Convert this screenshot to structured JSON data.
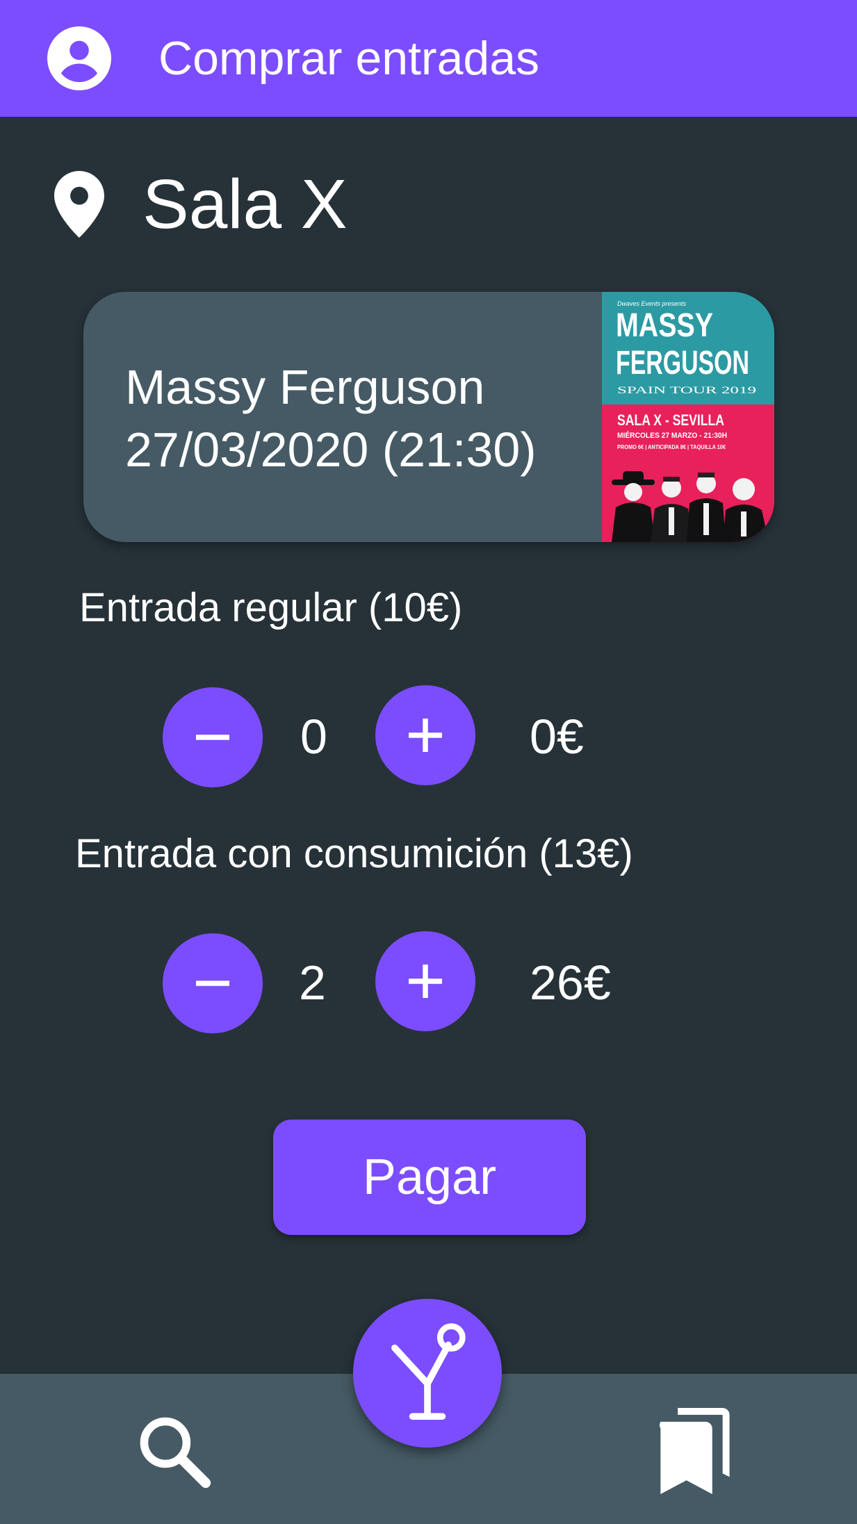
{
  "appbar": {
    "title": "Comprar entradas",
    "avatar_icon": "account-circle-icon"
  },
  "venue": {
    "icon": "location-pin-icon",
    "name": "Sala X"
  },
  "event": {
    "artist": "Massy Ferguson",
    "datetime": "27/03/2020 (21:30)",
    "poster": {
      "presenter": "Dwaves Events presents",
      "headline_line1": "MASSY",
      "headline_line2": "FERGUSON",
      "tour": "SPAIN TOUR 2019",
      "venue_city": "SALA X - SEVILLA",
      "date_line": "MIÉRCOLES 27 MARZO - 21:30H",
      "prices_line": "PROMO 6€ | ANTICIPADA 8€ | TAQUILLA 10€"
    }
  },
  "tickets": [
    {
      "label": "Entrada regular (10€)",
      "quantity": "0",
      "subtotal": "0€"
    },
    {
      "label": "Entrada con consumición (13€)",
      "quantity": "2",
      "subtotal": "26€"
    }
  ],
  "pay_button": {
    "label": "Pagar"
  },
  "bottom_nav": {
    "left_icon": "search-icon",
    "center_icon": "cocktail-logo-icon",
    "right_icon": "bookmarks-icon"
  },
  "colors": {
    "accent": "#7c4dff",
    "background": "#263238",
    "surface": "#455a64",
    "text": "#ffffff",
    "poster_teal": "#2c9aa3",
    "poster_pink": "#e8215b"
  }
}
